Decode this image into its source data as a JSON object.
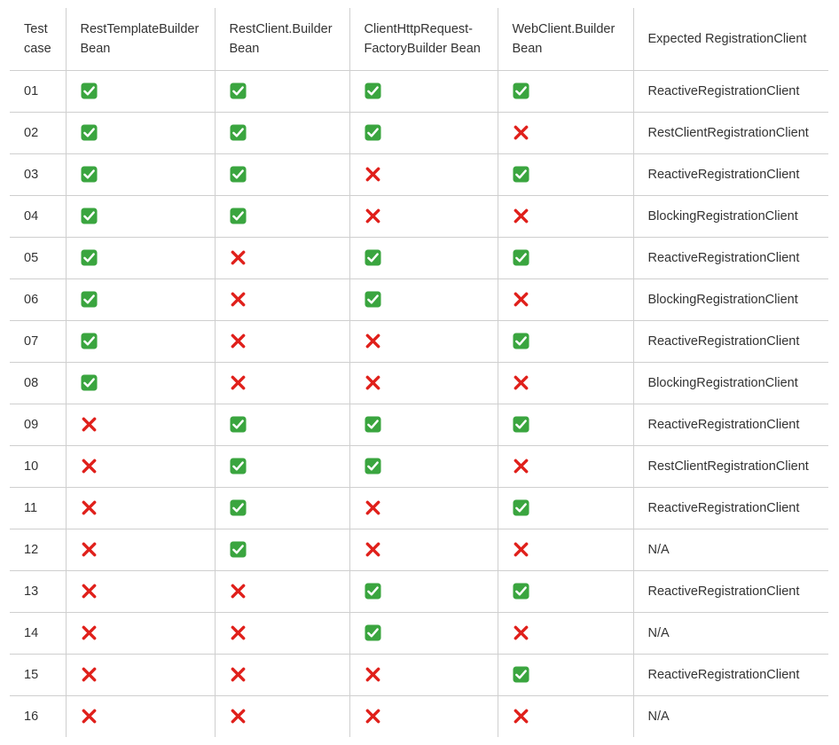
{
  "table": {
    "columns": [
      "Test case",
      "RestTemplateBuilder Bean",
      "RestClient.Builder Bean",
      "ClientHttpRequest-FactoryBuilder Bean",
      "WebClient.Builder Bean",
      "Expected RegistrationClient"
    ],
    "rows": [
      {
        "case": "01",
        "flags": [
          true,
          true,
          true,
          true
        ],
        "expected": "ReactiveRegistrationClient"
      },
      {
        "case": "02",
        "flags": [
          true,
          true,
          true,
          false
        ],
        "expected": "RestClientRegistrationClient"
      },
      {
        "case": "03",
        "flags": [
          true,
          true,
          false,
          true
        ],
        "expected": "ReactiveRegistrationClient"
      },
      {
        "case": "04",
        "flags": [
          true,
          true,
          false,
          false
        ],
        "expected": "BlockingRegistrationClient"
      },
      {
        "case": "05",
        "flags": [
          true,
          false,
          true,
          true
        ],
        "expected": "ReactiveRegistrationClient"
      },
      {
        "case": "06",
        "flags": [
          true,
          false,
          true,
          false
        ],
        "expected": "BlockingRegistrationClient"
      },
      {
        "case": "07",
        "flags": [
          true,
          false,
          false,
          true
        ],
        "expected": "ReactiveRegistrationClient"
      },
      {
        "case": "08",
        "flags": [
          true,
          false,
          false,
          false
        ],
        "expected": "BlockingRegistrationClient"
      },
      {
        "case": "09",
        "flags": [
          false,
          true,
          true,
          true
        ],
        "expected": "ReactiveRegistrationClient"
      },
      {
        "case": "10",
        "flags": [
          false,
          true,
          true,
          false
        ],
        "expected": "RestClientRegistrationClient"
      },
      {
        "case": "11",
        "flags": [
          false,
          true,
          false,
          true
        ],
        "expected": "ReactiveRegistrationClient"
      },
      {
        "case": "12",
        "flags": [
          false,
          true,
          false,
          false
        ],
        "expected": "N/A"
      },
      {
        "case": "13",
        "flags": [
          false,
          false,
          true,
          true
        ],
        "expected": "ReactiveRegistrationClient"
      },
      {
        "case": "14",
        "flags": [
          false,
          false,
          true,
          false
        ],
        "expected": "N/A"
      },
      {
        "case": "15",
        "flags": [
          false,
          false,
          false,
          true
        ],
        "expected": "ReactiveRegistrationClient"
      },
      {
        "case": "16",
        "flags": [
          false,
          false,
          false,
          false
        ],
        "expected": "N/A"
      }
    ]
  },
  "icons": {
    "yes": "check-mark-icon",
    "no": "cross-mark-icon"
  },
  "colors": {
    "check_bg": "#3aa53f",
    "cross": "#e0201b",
    "border": "#cfcfcf",
    "text": "#333333"
  }
}
